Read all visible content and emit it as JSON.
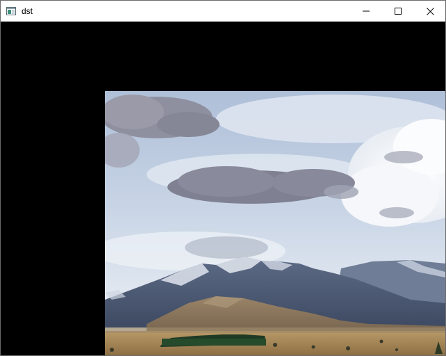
{
  "window": {
    "title": "dst",
    "icon": "app-window-icon"
  },
  "controls": {
    "minimize": "minimize-icon",
    "maximize": "maximize-icon",
    "close": "close-icon"
  },
  "canvas": {
    "background": "#000000",
    "image_description_icon": "photo-landscape"
  }
}
